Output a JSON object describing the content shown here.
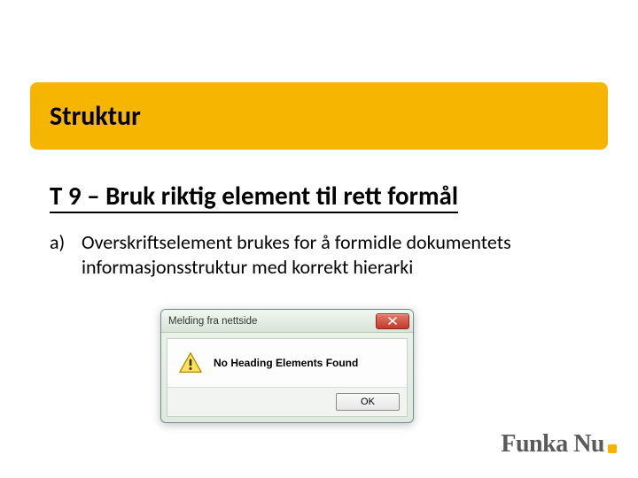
{
  "section_title": "Struktur",
  "heading": "T 9 – Bruk riktig element til rett formål",
  "list": {
    "marker": "a)",
    "text": "Overskriftselement brukes for å formidle dokumentets informasjonsstruktur med korrekt hierarki"
  },
  "dialog": {
    "title": "Melding fra nettside",
    "message": "No Heading Elements Found",
    "ok_label": "OK"
  },
  "logo": {
    "text": "Funka Nu"
  }
}
